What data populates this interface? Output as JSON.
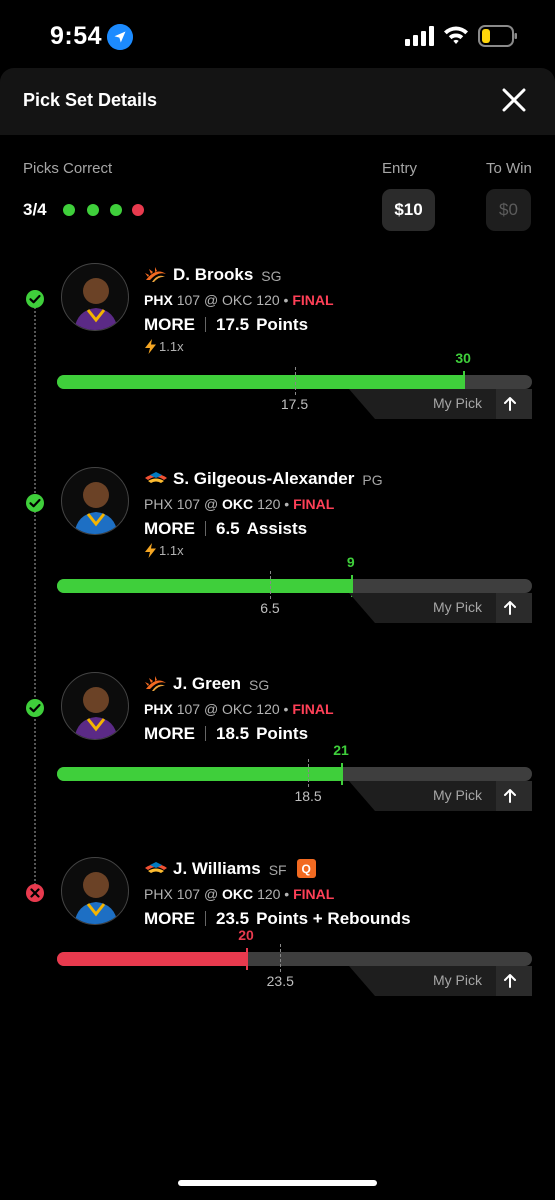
{
  "status_bar": {
    "time": "9:54"
  },
  "header": {
    "title": "Pick Set Details"
  },
  "summary": {
    "picks_correct_label": "Picks Correct",
    "picks_correct_value": "3/4",
    "results": [
      "correct",
      "correct",
      "correct",
      "incorrect"
    ],
    "entry_label": "Entry",
    "entry_value": "$10",
    "to_win_label": "To Win",
    "to_win_value": "$0"
  },
  "colors": {
    "correct": "#3fcf3b",
    "incorrect": "#e83a4e",
    "final": "#ff4057",
    "q_badge": "#f26a21"
  },
  "picks": [
    {
      "name": "D. Brooks",
      "position": "SG",
      "team_logo": "suns-logo",
      "status": "correct",
      "away_team": "PHX",
      "away_score": "107",
      "at": "@",
      "home_team": "OKC",
      "home_score": "120",
      "bold_team": "away",
      "game_state": "FINAL",
      "direction": "MORE",
      "line": "17.5",
      "stat": "Points",
      "multiplier": "1.1x",
      "actual": "30",
      "line_value": 17.5,
      "actual_value": 30,
      "my_pick_label": "My Pick"
    },
    {
      "name": "S. Gilgeous-Alexander",
      "position": "PG",
      "team_logo": "thunder-logo",
      "status": "correct",
      "away_team": "PHX",
      "away_score": "107",
      "at": "@",
      "home_team": "OKC",
      "home_score": "120",
      "bold_team": "home",
      "game_state": "FINAL",
      "direction": "MORE",
      "line": "6.5",
      "stat": "Assists",
      "multiplier": "1.1x",
      "actual": "9",
      "line_value": 6.5,
      "actual_value": 9,
      "my_pick_label": "My Pick"
    },
    {
      "name": "J. Green",
      "position": "SG",
      "team_logo": "suns-logo",
      "status": "correct",
      "away_team": "PHX",
      "away_score": "107",
      "at": "@",
      "home_team": "OKC",
      "home_score": "120",
      "bold_team": "away",
      "game_state": "FINAL",
      "direction": "MORE",
      "line": "18.5",
      "stat": "Points",
      "actual": "21",
      "line_value": 18.5,
      "actual_value": 21,
      "my_pick_label": "My Pick"
    },
    {
      "name": "J. Williams",
      "position": "SF",
      "badge": "Q",
      "team_logo": "thunder-logo",
      "status": "incorrect",
      "away_team": "PHX",
      "away_score": "107",
      "at": "@",
      "home_team": "OKC",
      "home_score": "120",
      "bold_team": "home",
      "game_state": "FINAL",
      "direction": "MORE",
      "line": "23.5",
      "stat": "Points + Rebounds",
      "actual": "20",
      "line_value": 23.5,
      "actual_value": 20,
      "my_pick_label": "My Pick"
    }
  ]
}
